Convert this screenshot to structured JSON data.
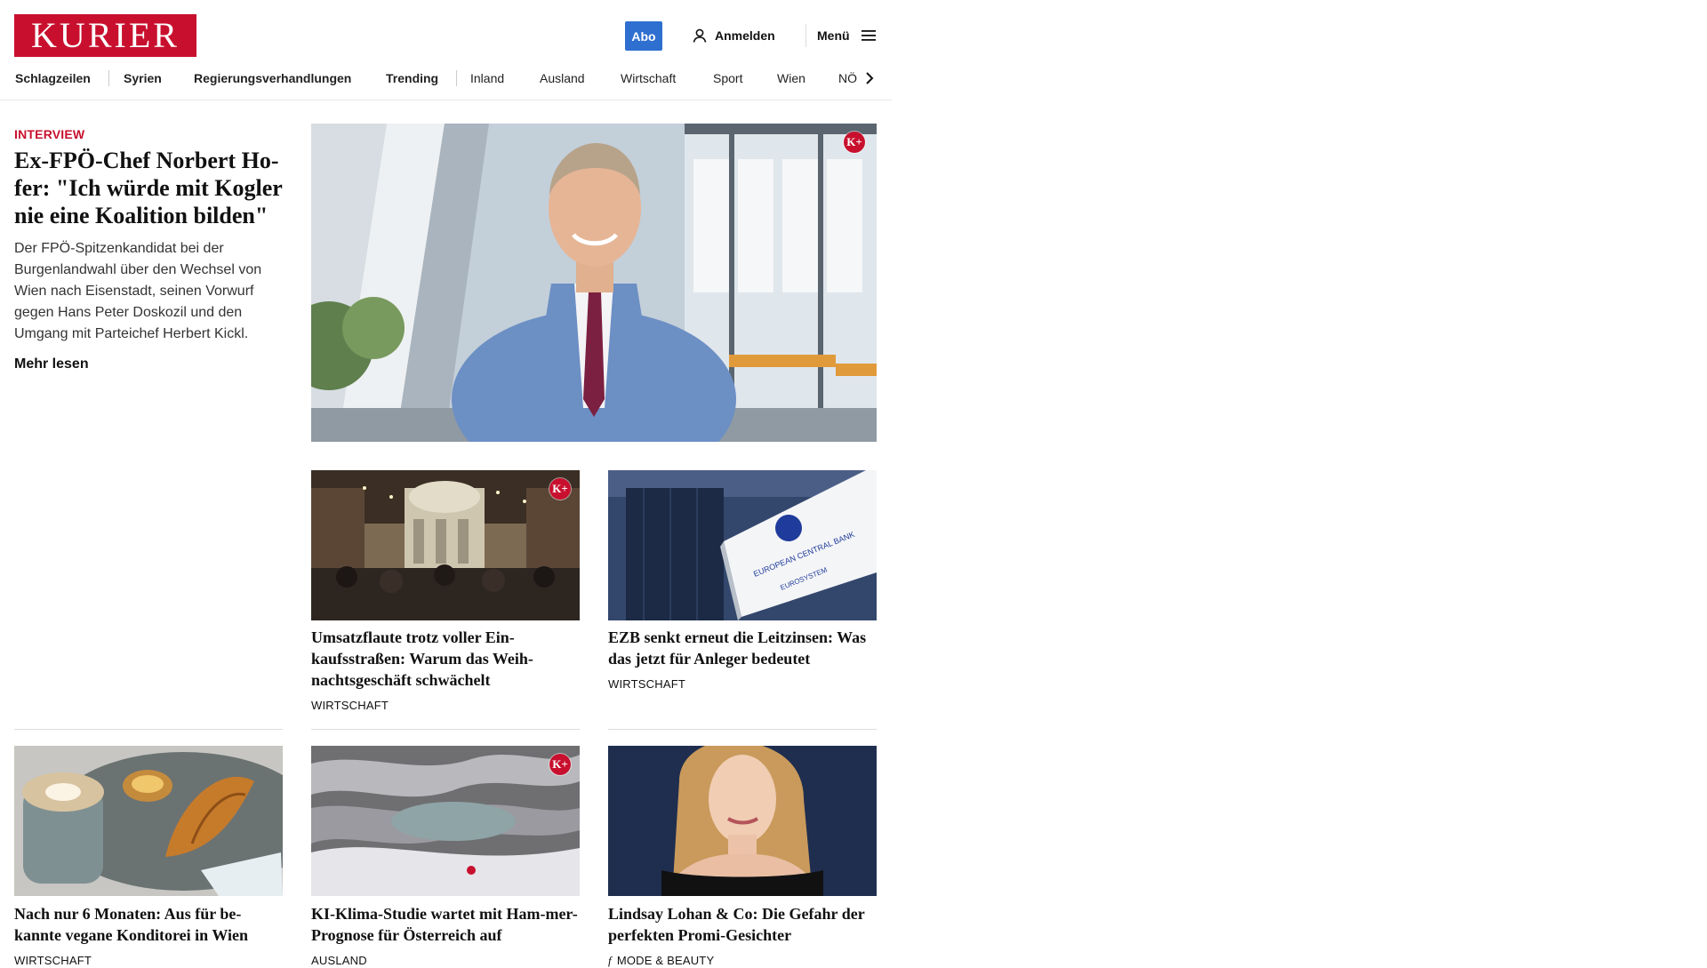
{
  "header": {
    "logo": "KURIER",
    "abo_label": "Abo",
    "login_label": "Anmelden",
    "menu_label": "Menü"
  },
  "nav": {
    "items": [
      "Schlagzeilen",
      "Syrien",
      "Regierungsverhandlungen",
      "Trending",
      "Inland",
      "Ausland",
      "Wirtschaft",
      "Sport",
      "Wien",
      "NÖ"
    ]
  },
  "lead": {
    "kicker": "INTERVIEW",
    "title": "Ex-FPÖ-Chef Norbert Ho-fer: \"Ich würde mit Kogler nie eine Koalition bilden\"",
    "teaser": "Der FPÖ-Spitzenkandidat bei der Burgenlandwahl über den Wechsel von Wien nach Eisenstadt, seinen Vorwurf gegen Hans Peter Doskozil und den Umgang mit Parteichef Herbert Kickl.",
    "more": "Mehr lesen",
    "badge": "K+"
  },
  "cards": [
    {
      "title": "Umsatzflaute trotz voller Ein-kaufsstraßen: Warum das Weih-nachtsgeschäft schwächelt",
      "category": "WIRTSCHAFT",
      "badge": "K+"
    },
    {
      "title": "EZB senkt erneut die Leitzinsen: Was das jetzt für Anleger bedeutet",
      "category": "WIRTSCHAFT",
      "image_text_1": "EUROPEAN CENTRAL BANK",
      "image_text_2": "EUROSYSTEM"
    },
    {
      "title": "Nach nur 6 Monaten: Aus für be-kannte vegane Konditorei in Wien",
      "category": "WIRTSCHAFT"
    },
    {
      "title": "KI-Klima-Studie wartet mit Ham-mer-Prognose für Österreich auf",
      "category": "AUSLAND",
      "badge": "K+"
    },
    {
      "title": "Lindsay Lohan & Co: Die Gefahr der perfekten Promi-Gesichter",
      "category": "MODE & BEAUTY",
      "category_icon": "f"
    }
  ],
  "colors": {
    "brand": "#c8102e",
    "abo": "#2f6fd0"
  }
}
